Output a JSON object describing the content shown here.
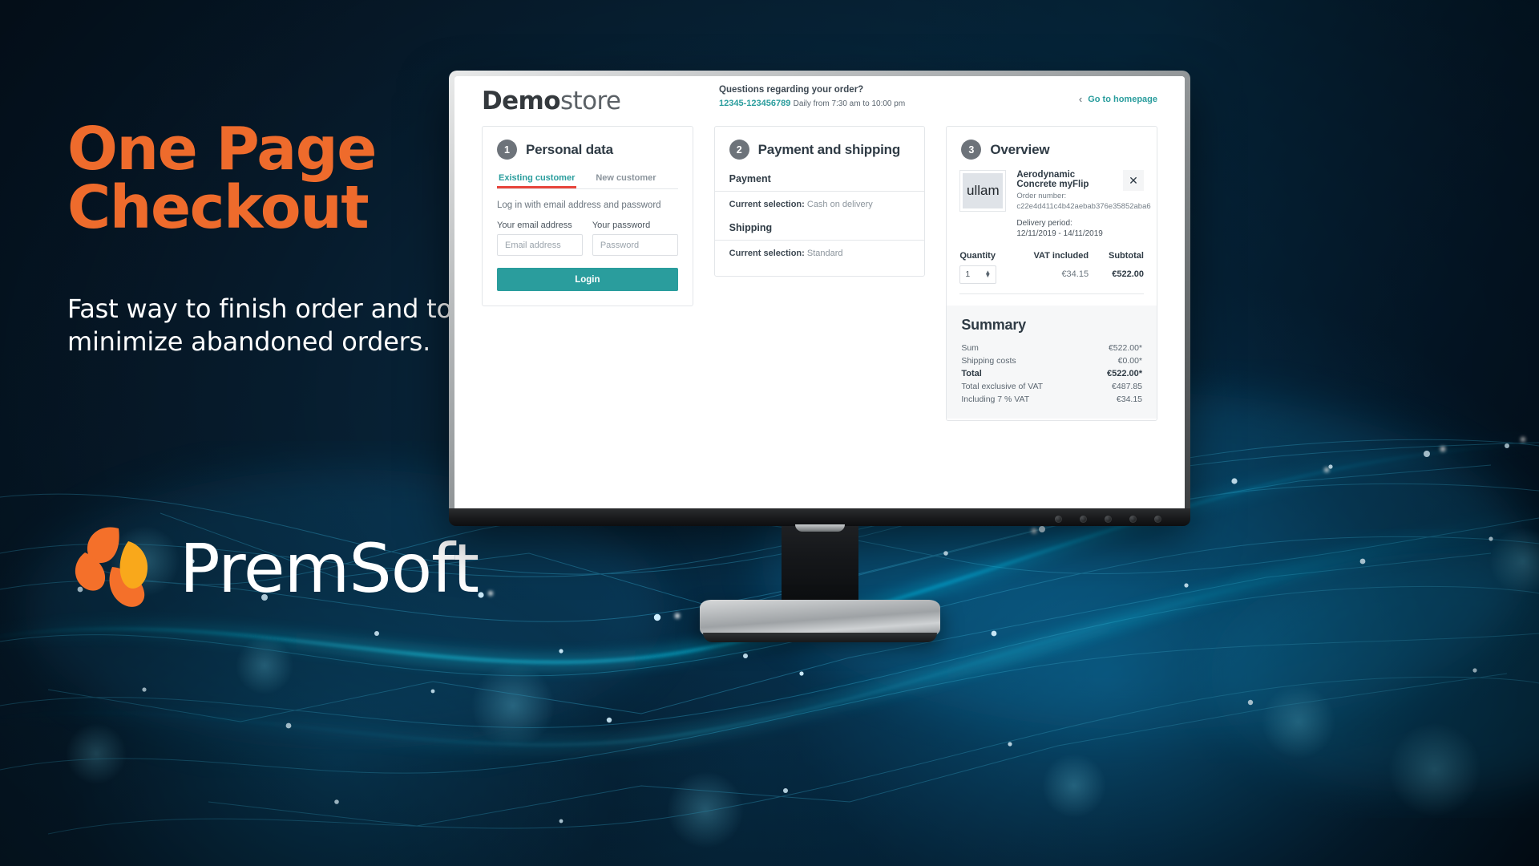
{
  "promo": {
    "headline_line1": "One Page",
    "headline_line2": "Checkout",
    "subhead": "Fast way to finish order and to minimize abandoned orders.",
    "logo_text": "PremSoft",
    "accent_orange": "#ee6b2c",
    "accent_yellow": "#f5a623",
    "bg_navy": "#061728"
  },
  "store": {
    "brand_bold": "Demo",
    "brand_light": "store",
    "header": {
      "question": "Questions regarding your order?",
      "phone": "12345-123456789",
      "hours": "Daily from 7:30 am to 10:00 pm",
      "homepage_link": "Go to homepage",
      "back_chevron": "‹"
    },
    "card_personal": {
      "step": "1",
      "title": "Personal data",
      "tabs": [
        {
          "label": "Existing customer",
          "active": true
        },
        {
          "label": "New customer",
          "active": false
        }
      ],
      "hint": "Log in with email address and password",
      "email_label": "Your email address",
      "email_placeholder": "Email address",
      "email_value": "",
      "password_label": "Your password",
      "password_placeholder": "Password",
      "password_value": "",
      "login_button": "Login",
      "active_tab_color": "#2a9d9d",
      "underline_color": "#e8453c"
    },
    "card_payment": {
      "step": "2",
      "title": "Payment and shipping",
      "payment_heading": "Payment",
      "payment_selection_label": "Current selection:",
      "payment_selection_value": "Cash on delivery",
      "shipping_heading": "Shipping",
      "shipping_selection_label": "Current selection:",
      "shipping_selection_value": "Standard"
    },
    "card_overview": {
      "step": "3",
      "title": "Overview",
      "thumb_text": "ullam",
      "product_name": "Aerodynamic Concrete myFlip",
      "order_number_label": "Order number:",
      "order_number_value": "c22e4d411c4b42aebab376e35852aba6",
      "delivery_period": "Delivery period: 12/11/2019 - 14/11/2019",
      "remove_icon": "✕",
      "col_quantity": "Quantity",
      "col_vat": "VAT included",
      "col_subtotal": "Subtotal",
      "quantity_value": "1",
      "vat_value": "€34.15",
      "subtotal_value": "€522.00",
      "summary_title": "Summary",
      "summary_rows": [
        {
          "label": "Sum",
          "value": "€522.00*",
          "bold": false
        },
        {
          "label": "Shipping costs",
          "value": "€0.00*",
          "bold": false
        },
        {
          "label": "Total",
          "value": "€522.00*",
          "bold": true
        },
        {
          "label": "Total exclusive of VAT",
          "value": "€487.85",
          "bold": false
        },
        {
          "label": "Including 7 % VAT",
          "value": "€34.15",
          "bold": false
        }
      ]
    }
  }
}
